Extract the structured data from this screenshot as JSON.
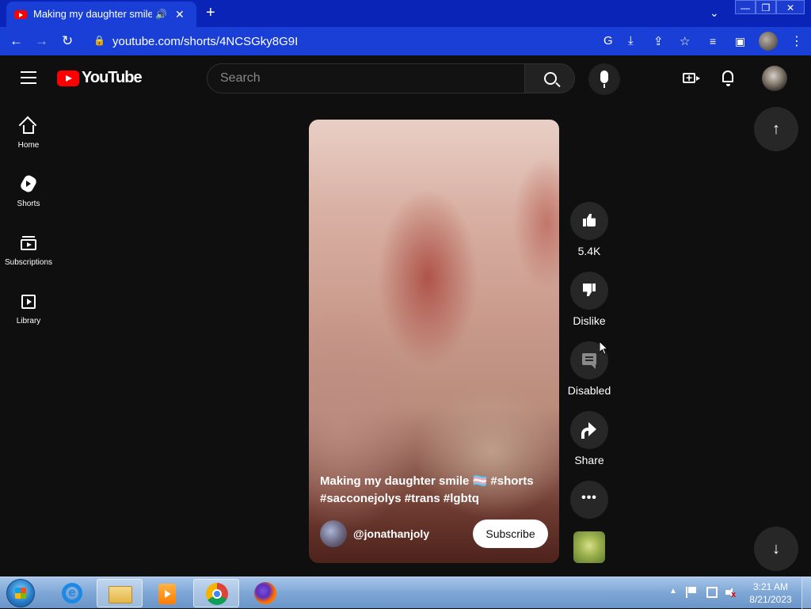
{
  "browser": {
    "tab_title": "Making my daughter smile 🏳️‍⚧️",
    "tab_audio_icon": "speaker-icon",
    "tab_close": "✕",
    "new_tab": "+",
    "tab_dropdown": "⌄",
    "window_min": "—",
    "window_max": "❐",
    "window_close": "✕",
    "url": "youtube.com/shorts/4NCSGky8G9I"
  },
  "youtube": {
    "logo_text": "YouTube",
    "search_placeholder": "Search",
    "guide": [
      {
        "label": "Home"
      },
      {
        "label": "Shorts"
      },
      {
        "label": "Subscriptions"
      },
      {
        "label": "Library"
      }
    ],
    "short": {
      "title": "Making my daughter smile 🏳️‍⚧️ #shorts #sacconejolys #trans #lgbtq",
      "channel_handle": "@jonathanjoly",
      "subscribe_label": "Subscribe"
    },
    "actions": {
      "like_count": "5.4K",
      "dislike_label": "Dislike",
      "comments_label": "Disabled",
      "share_label": "Share",
      "more_label": "•••"
    },
    "nav": {
      "up": "↑",
      "down": "↓"
    }
  },
  "taskbar": {
    "time": "3:21 AM",
    "date": "8/21/2023",
    "tray_expand": "▲"
  },
  "colors": {
    "titlebar": "#0a24b8",
    "toolbar": "#1a3fd6",
    "yt_background": "#0f0f0f",
    "yt_red": "#ff0000",
    "action_circle": "#272727"
  }
}
